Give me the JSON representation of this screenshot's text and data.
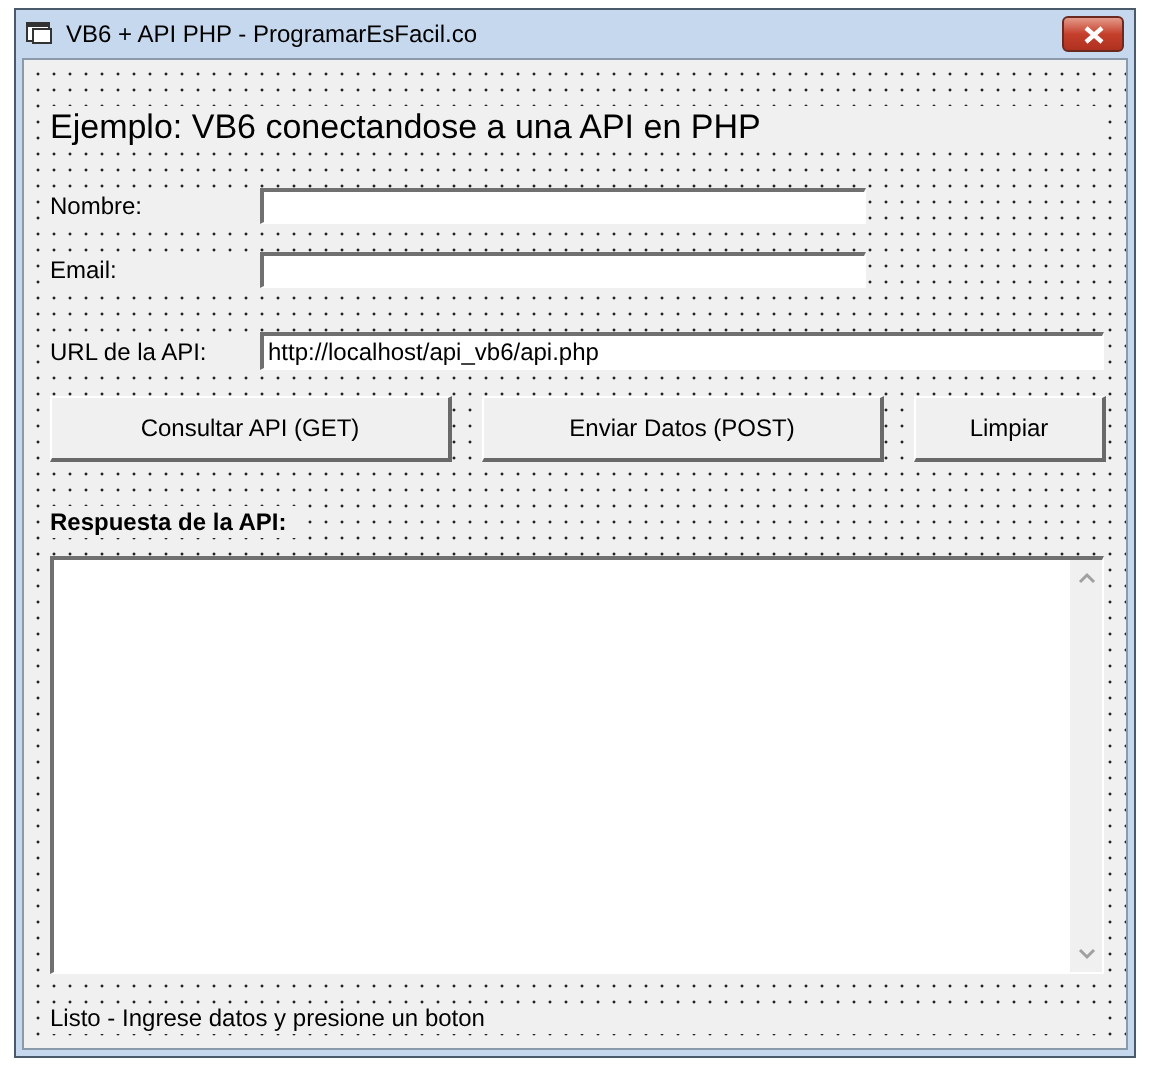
{
  "window": {
    "title": "VB6 + API PHP - ProgramarEsFacil.co"
  },
  "heading": "Ejemplo: VB6 conectandose a una API en PHP",
  "fields": [
    {
      "label": "Nombre:"
    },
    {
      "label": "Email:"
    },
    {
      "label": "URL de la API:",
      "value": "http://localhost/api_vb6/api.php"
    }
  ],
  "buttons": [
    "Consultar API (GET)",
    "Enviar Datos (POST)",
    "Limpiar"
  ],
  "response": {
    "label": "Respuesta de la API:"
  },
  "status_bar": "Listo - Ingrese datos y presione un boton"
}
